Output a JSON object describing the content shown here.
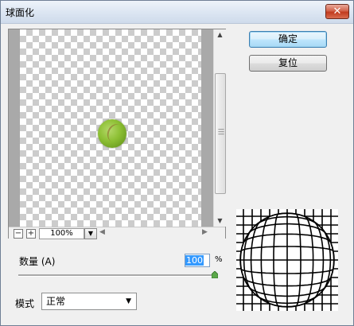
{
  "dialog": {
    "title": "球面化",
    "close_glyph": "✕"
  },
  "buttons": {
    "ok": "确定",
    "reset": "复位"
  },
  "preview": {
    "zoom_out": "−",
    "zoom_in": "+",
    "zoom_value": "100%"
  },
  "amount": {
    "label": "数量 (A)",
    "value": "100",
    "unit": "%",
    "level_percent": 100
  },
  "mode": {
    "label": "模式",
    "selected": "正常"
  },
  "colors": {
    "accent": "#3c7fb1",
    "close": "#c23b1f",
    "selection": "#3399ff"
  }
}
